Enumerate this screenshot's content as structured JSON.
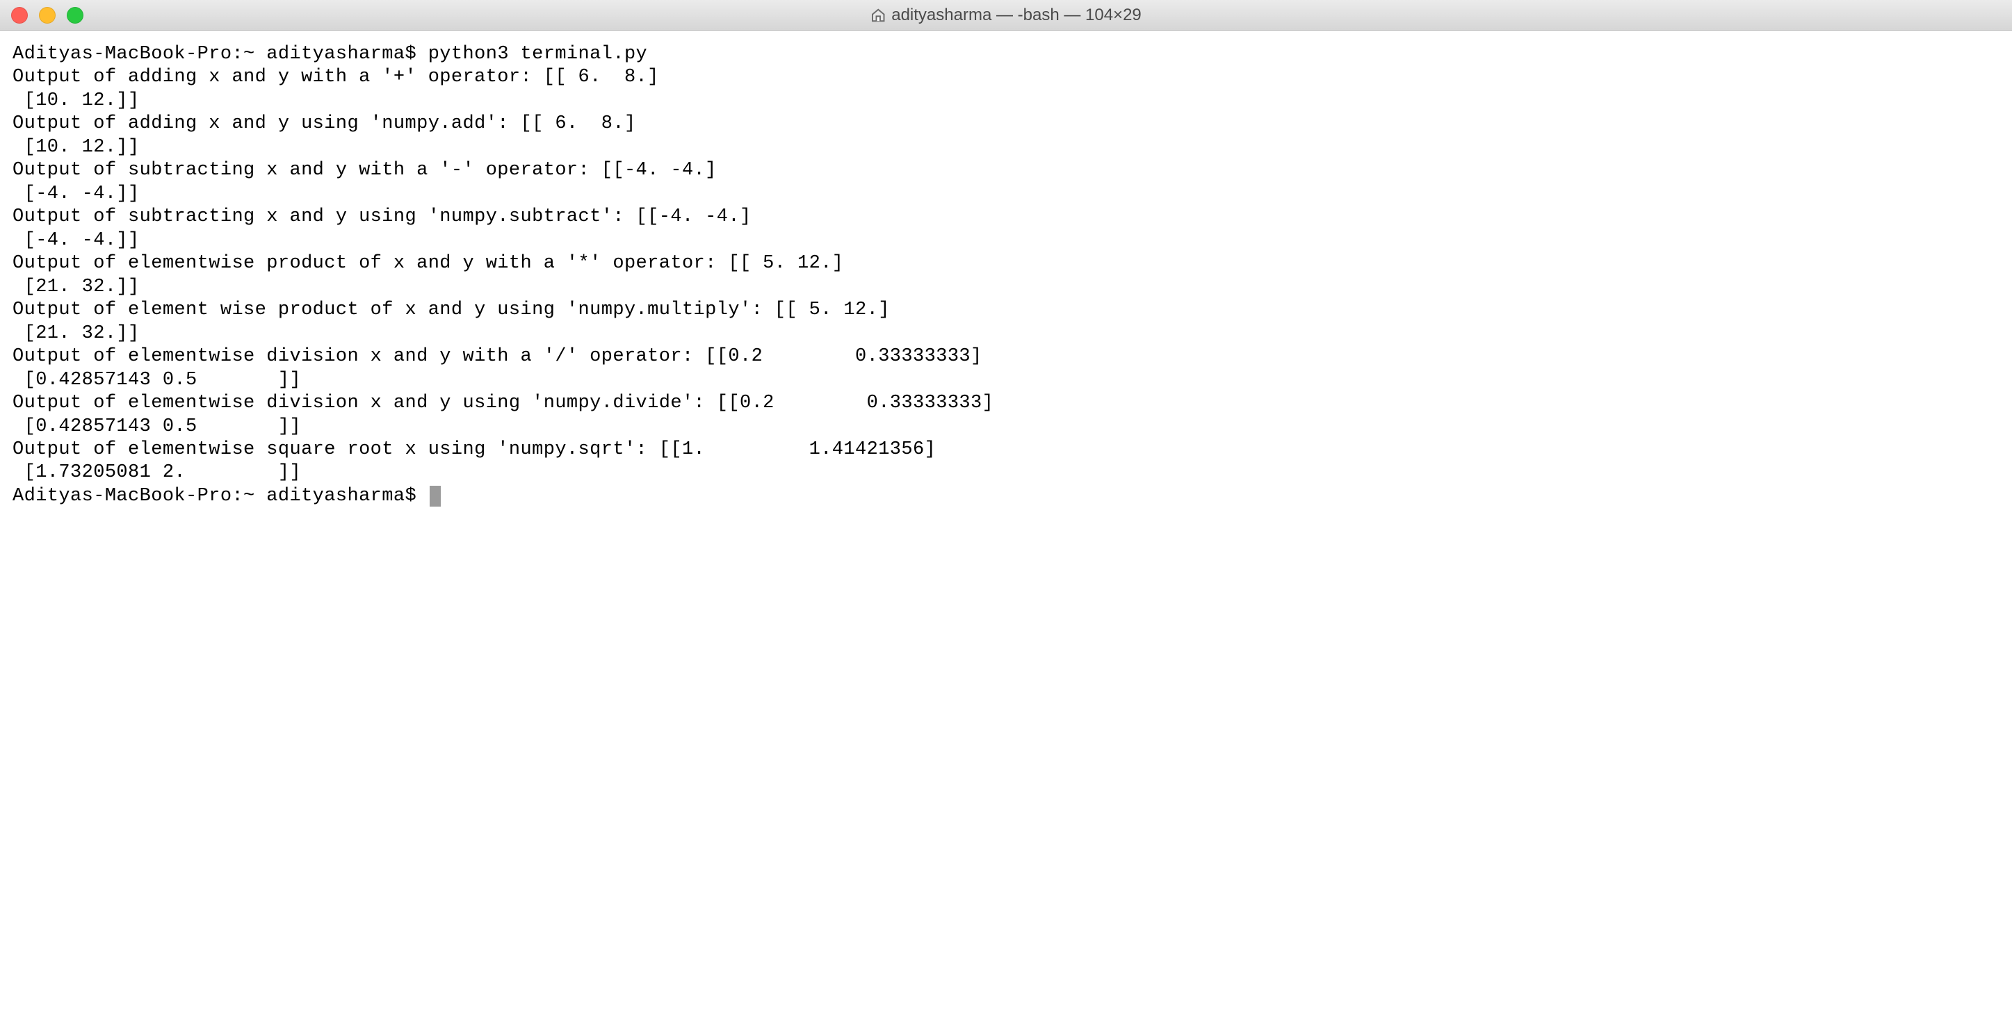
{
  "window": {
    "title": "adityasharma — -bash — 104×29"
  },
  "terminal": {
    "prompt1_host": "Adityas-MacBook-Pro:~ adityasharma$ ",
    "prompt1_cmd": "python3 terminal.py",
    "lines": [
      "Output of adding x and y with a '+' operator: [[ 6.  8.]",
      " [10. 12.]]",
      "Output of adding x and y using 'numpy.add': [[ 6.  8.]",
      " [10. 12.]]",
      "Output of subtracting x and y with a '-' operator: [[-4. -4.]",
      " [-4. -4.]]",
      "Output of subtracting x and y using 'numpy.subtract': [[-4. -4.]",
      " [-4. -4.]]",
      "Output of elementwise product of x and y with a '*' operator: [[ 5. 12.]",
      " [21. 32.]]",
      "Output of element wise product of x and y using 'numpy.multiply': [[ 5. 12.]",
      " [21. 32.]]",
      "Output of elementwise division x and y with a '/' operator: [[0.2        0.33333333]",
      " [0.42857143 0.5       ]]",
      "Output of elementwise division x and y using 'numpy.divide': [[0.2        0.33333333]",
      " [0.42857143 0.5       ]]",
      "Output of elementwise square root x using 'numpy.sqrt': [[1.         1.41421356]",
      " [1.73205081 2.        ]]"
    ],
    "prompt2_host": "Adityas-MacBook-Pro:~ adityasharma$ "
  }
}
